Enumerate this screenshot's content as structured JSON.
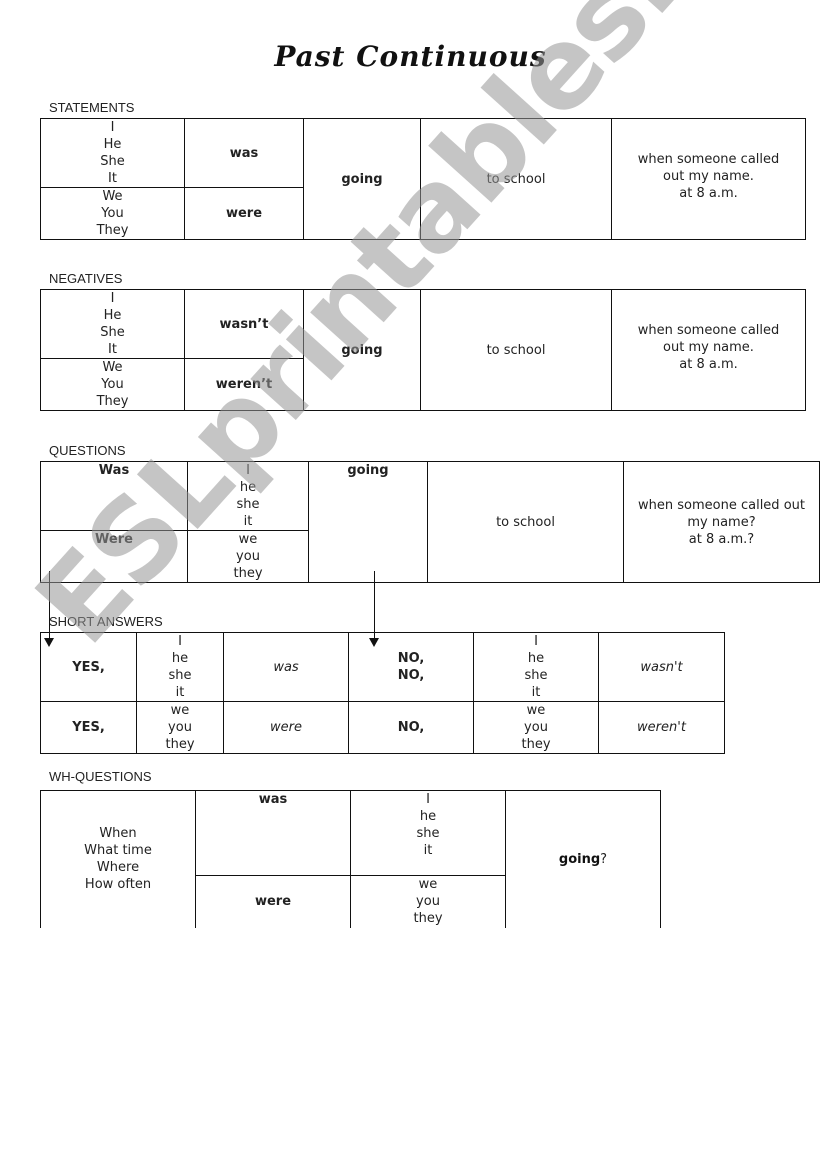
{
  "title": "Past Continuous",
  "watermark": "ESLprintables.com",
  "statements": {
    "label": "STATEMENTS",
    "subjects_singular": "I\nHe\nShe\nIt",
    "subjects_plural": "We\nYou\nThey",
    "aux_singular": "was",
    "aux_plural": "were",
    "verb": "going",
    "place": "to school",
    "time": "when someone called\nout my name.\nat 8 a.m."
  },
  "negatives": {
    "label": "NEGATIVES",
    "subjects_singular": "I\nHe\nShe\nIt",
    "subjects_plural": "We\nYou\nThey",
    "aux_singular": "wasn’t",
    "aux_plural": "weren’t",
    "verb": "going",
    "place": "to school",
    "time": "when someone called\nout my name.\nat 8 a.m."
  },
  "questions": {
    "label": "QUESTIONS",
    "aux_singular": "Was",
    "aux_plural": "Were",
    "subjects_singular": "I\nhe\nshe\nit",
    "subjects_plural": "we\nyou\nthey",
    "verb": "going",
    "place": "to school",
    "time": "when someone called out\nmy name?\nat 8 a.m.?"
  },
  "short_answers": {
    "label": "SHORT ANSWERS",
    "rows": [
      {
        "yes": "YES,",
        "subjects": "I\nhe\nshe\nit",
        "aux": "was",
        "no": "NO,\nNO,",
        "subjects2": "I\nhe\nshe\nit",
        "neg": "wasn't"
      },
      {
        "yes": "YES,",
        "subjects": "we\nyou\nthey",
        "aux": "were",
        "no": "NO,",
        "subjects2": "we\nyou\nthey",
        "neg": "weren't"
      }
    ]
  },
  "wh_questions": {
    "label": "WH-QUESTIONS",
    "wh_words": "When\nWhat time\nWhere\nHow often",
    "aux_singular": "was",
    "aux_plural": "were",
    "subjects_singular": "I\nhe\nshe\nit",
    "subjects_plural": "we\nyou\nthey",
    "verb": "going",
    "verb_suffix": "?"
  }
}
